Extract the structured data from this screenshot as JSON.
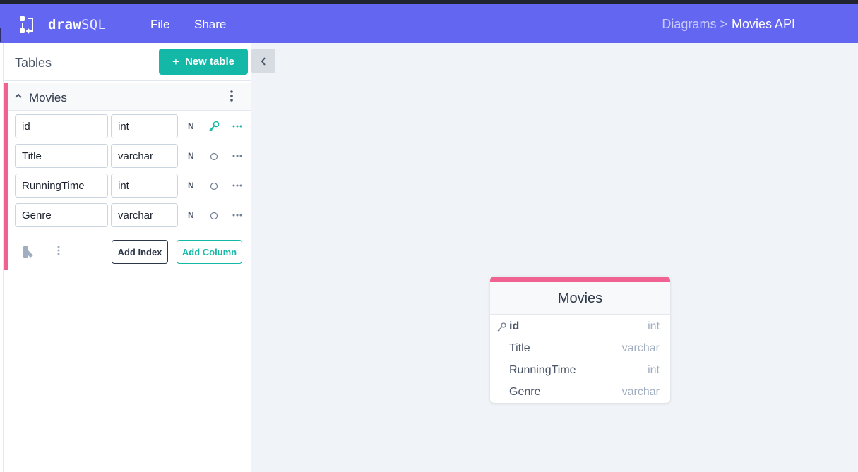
{
  "colors": {
    "navbar": "#6366f1",
    "accent": "#14b8a6",
    "table_accent": "#f06292",
    "canvas": "#f0f4f8"
  },
  "navbar": {
    "brand_bold": "draw",
    "brand_light": "SQL",
    "menu": [
      "File",
      "Share"
    ],
    "breadcrumb_parent": "Diagrams >",
    "breadcrumb_current": "Movies API"
  },
  "sidebar": {
    "title": "Tables",
    "new_table_label": "New table",
    "new_table_icon": "plus-icon",
    "collapse_icon": "chevron-left-icon",
    "table": {
      "name": "Movies",
      "columns": [
        {
          "name": "id",
          "type": "int",
          "nullable_label": "N",
          "primary_key": true
        },
        {
          "name": "Title",
          "type": "varchar",
          "nullable_label": "N",
          "primary_key": false
        },
        {
          "name": "RunningTime",
          "type": "int",
          "nullable_label": "N",
          "primary_key": false
        },
        {
          "name": "Genre",
          "type": "varchar",
          "nullable_label": "N",
          "primary_key": false
        }
      ],
      "add_index_label": "Add Index",
      "add_column_label": "Add Column"
    }
  },
  "canvas": {
    "card": {
      "title": "Movies",
      "rows": [
        {
          "name": "id",
          "type": "int",
          "pk": true
        },
        {
          "name": "Title",
          "type": "varchar",
          "pk": false
        },
        {
          "name": "RunningTime",
          "type": "int",
          "pk": false
        },
        {
          "name": "Genre",
          "type": "varchar",
          "pk": false
        }
      ]
    }
  }
}
